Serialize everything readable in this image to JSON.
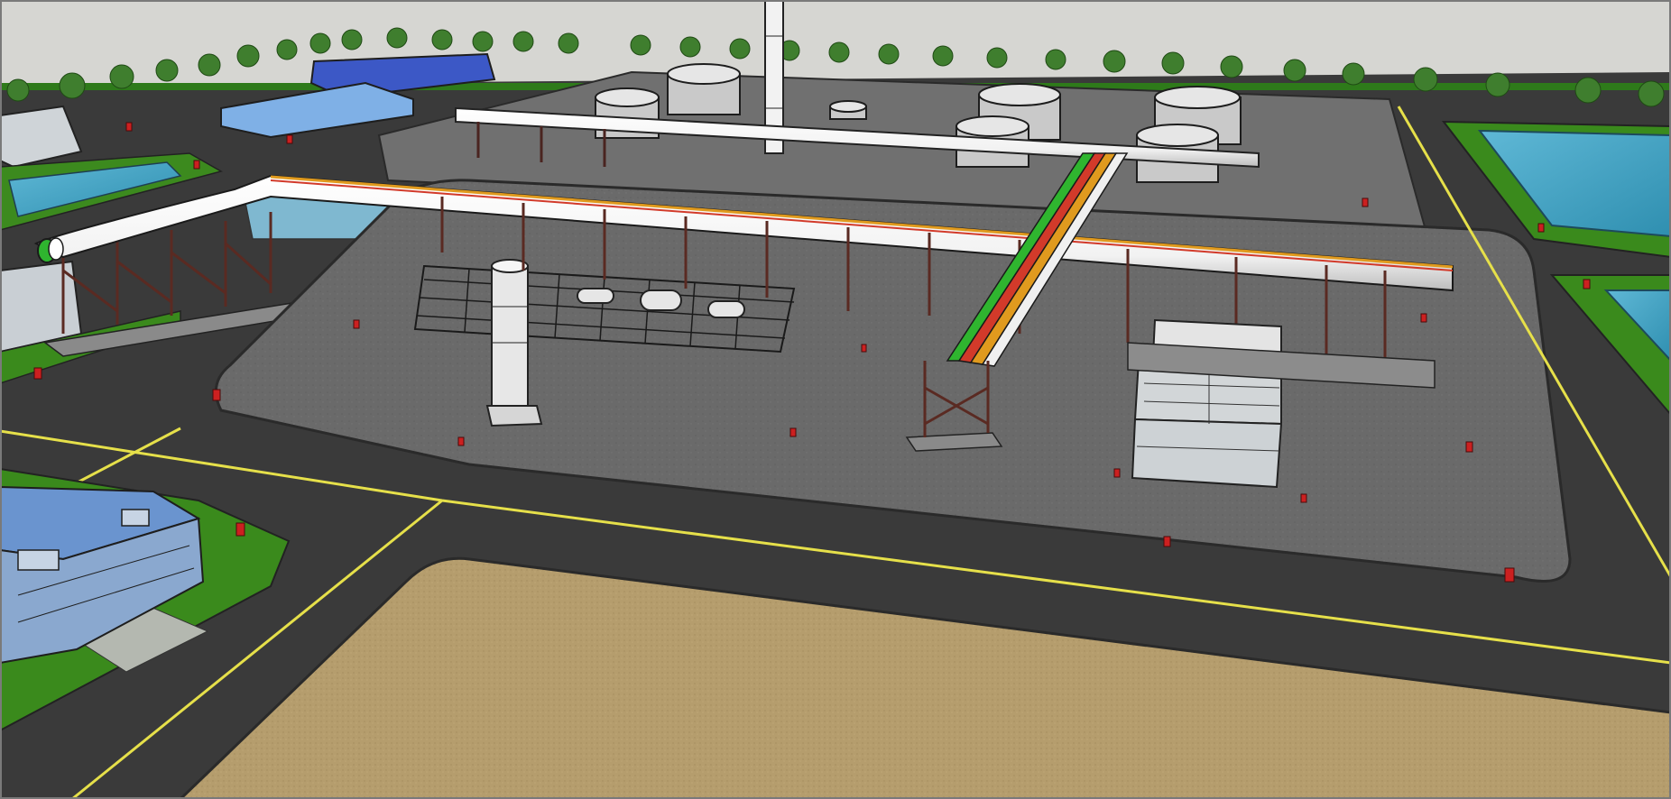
{
  "viewport": {
    "label": "",
    "colors": {
      "sky": "#d7d7d3",
      "road": "#3a3a3a",
      "road_line": "#e6e04a",
      "plant_slab": "#6e6e6e",
      "grass": "#3d8a1f",
      "sand": "#b49c6c",
      "water": "#4aa6c2",
      "building_blue": "#5b8fd9",
      "steel": "#5a2a22",
      "pipe_main": "#ffffff",
      "pipe_green": "#2fb52f",
      "pipe_orange": "#e09a1e",
      "pipe_red": "#d23a2a",
      "hydrant": "#cc2020"
    },
    "icons": [
      "hydrant-icon",
      "tree-icon",
      "tank-icon",
      "chimney-icon",
      "pipe-rack-icon",
      "column-tower-icon"
    ]
  }
}
